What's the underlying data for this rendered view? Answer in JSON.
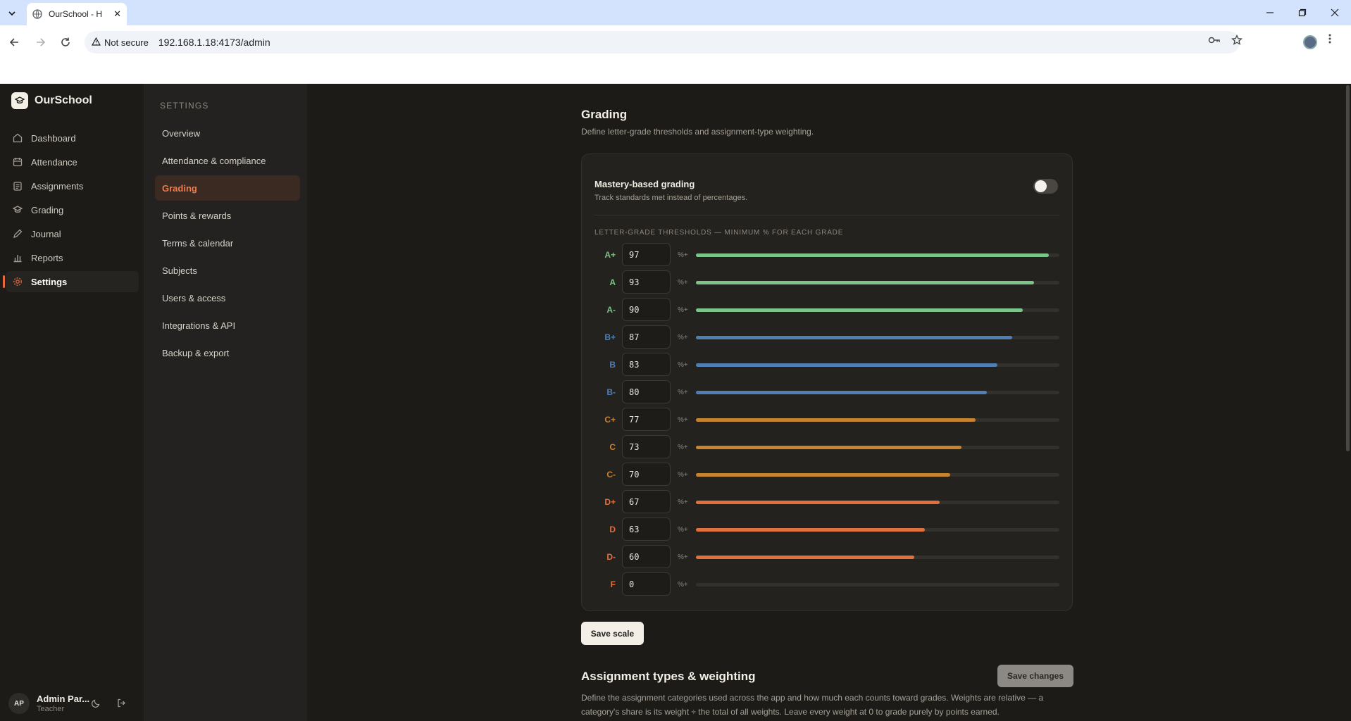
{
  "browser": {
    "tab_title": "OurSchool - H",
    "tab_close": "✕",
    "security_label": "Not secure",
    "url": "192.168.1.18:4173/admin"
  },
  "app": {
    "name": "OurSchool"
  },
  "nav": {
    "items": [
      {
        "label": "Dashboard",
        "icon": "dashboard-icon"
      },
      {
        "label": "Attendance",
        "icon": "calendar-icon"
      },
      {
        "label": "Assignments",
        "icon": "clipboard-icon"
      },
      {
        "label": "Grading",
        "icon": "graduation-cap-icon"
      },
      {
        "label": "Journal",
        "icon": "pen-icon"
      },
      {
        "label": "Reports",
        "icon": "bar-chart-icon"
      },
      {
        "label": "Settings",
        "icon": "gear-icon",
        "active": true
      }
    ]
  },
  "user": {
    "initials": "AP",
    "name": "Admin Par...",
    "role": "Teacher"
  },
  "settings_nav": {
    "header": "SETTINGS",
    "items": [
      {
        "label": "Overview"
      },
      {
        "label": "Attendance & compliance"
      },
      {
        "label": "Grading",
        "active": true
      },
      {
        "label": "Points & rewards"
      },
      {
        "label": "Terms & calendar"
      },
      {
        "label": "Subjects"
      },
      {
        "label": "Users & access"
      },
      {
        "label": "Integrations & API"
      },
      {
        "label": "Backup & export"
      }
    ]
  },
  "grading": {
    "title": "Grading",
    "subtitle": "Define letter-grade thresholds and assignment-type weighting.",
    "mastery": {
      "title": "Mastery-based grading",
      "subtitle": "Track standards met instead of percentages.",
      "enabled": false
    },
    "thresholds_header": "LETTER-GRADE THRESHOLDS — MINIMUM % FOR EACH GRADE",
    "percent_suffix": "%+",
    "colors": {
      "A": "#7cc48a",
      "B": "#4f7fb5",
      "C": "#c8832f",
      "D": "#e1703c",
      "F": "#e1703c"
    },
    "thresholds": [
      {
        "grade": "A+",
        "min": "97",
        "family": "A"
      },
      {
        "grade": "A",
        "min": "93",
        "family": "A"
      },
      {
        "grade": "A-",
        "min": "90",
        "family": "A"
      },
      {
        "grade": "B+",
        "min": "87",
        "family": "B"
      },
      {
        "grade": "B",
        "min": "83",
        "family": "B"
      },
      {
        "grade": "B-",
        "min": "80",
        "family": "B"
      },
      {
        "grade": "C+",
        "min": "77",
        "family": "C"
      },
      {
        "grade": "C",
        "min": "73",
        "family": "C"
      },
      {
        "grade": "C-",
        "min": "70",
        "family": "C"
      },
      {
        "grade": "D+",
        "min": "67",
        "family": "D"
      },
      {
        "grade": "D",
        "min": "63",
        "family": "D"
      },
      {
        "grade": "D-",
        "min": "60",
        "family": "D"
      },
      {
        "grade": "F",
        "min": "0",
        "family": "F"
      }
    ],
    "save_scale_label": "Save scale"
  },
  "weighting": {
    "title": "Assignment types & weighting",
    "save_label": "Save changes",
    "description": "Define the assignment categories used across the app and how much each counts toward grades. Weights are relative — a category's share is its weight ÷ the total of all weights. Leave every weight at 0 to grade purely by points earned."
  }
}
